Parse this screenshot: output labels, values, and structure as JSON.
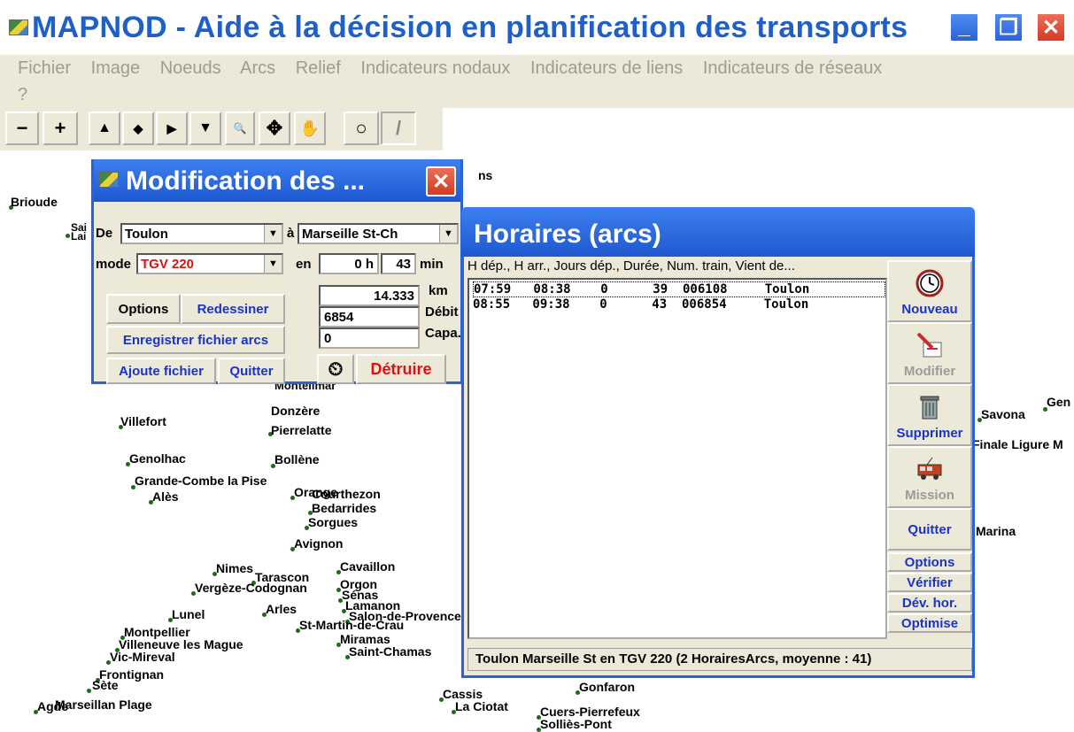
{
  "window": {
    "title": "MAPNOD - Aide à la décision en planification des transports"
  },
  "menu": {
    "items": [
      "Fichier",
      "Image",
      "Noeuds",
      "Arcs",
      "Relief",
      "Indicateurs nodaux",
      "Indicateurs de liens",
      "Indicateurs de réseaux"
    ],
    "help": "?"
  },
  "toolbar": {
    "buttons": [
      "−",
      "+",
      "▲",
      "◆",
      "▶",
      "▼",
      "🔍",
      "✥",
      "✋",
      "○",
      "/"
    ]
  },
  "map": {
    "cities": [
      "Brioude",
      "Sai",
      "Lai",
      "Villefort",
      "Donzère",
      "Pierrelatte",
      "Genolhac",
      "Bollène",
      "Grande-Combe la Pise",
      "Alès",
      "Orange",
      "Courthezon",
      "Bedarrides",
      "Sorgues",
      "Avignon",
      "Nimes",
      "Tarascon",
      "Cavaillon",
      "Vergèze-Codognan",
      "Orgon",
      "Sénas",
      "Lamanon",
      "Arles",
      "Lunel",
      "Salon-de-Provence",
      "St-Martin-de-Crau",
      "Montpellier",
      "Villeneuve les Mague",
      "Vic-Mireval",
      "Miramas",
      "Saint-Chamas",
      "Frontignan",
      "Sète",
      "Agde",
      "Marseillan Plage",
      "Cassis",
      "La Ciotat",
      "Gonfaron",
      "Cuers-Pierrefeux",
      "Solliès-Pont",
      "Savona",
      "Finale Ligure M",
      "Gen",
      "Marina",
      "Montelimar",
      "ns"
    ]
  },
  "modif": {
    "title": "Modification des ...",
    "de_label": "De",
    "de_value": "Toulon",
    "a_label": "à",
    "a_value": "Marseille St-Ch",
    "mode_label": "mode",
    "mode_value": "TGV 220",
    "en_label": "en",
    "hours": "0 h",
    "minutes": "43",
    "min_label": "min",
    "km_value": "14.333",
    "km_label": "km",
    "debit_value": "6854",
    "debit_label": "Débit",
    "capa_value": "0",
    "capa_label": "Capa.",
    "btn_options": "Options",
    "btn_redessiner": "Redessiner",
    "btn_enregistrer": "Enregistrer fichier arcs",
    "btn_ajoute": "Ajoute fichier",
    "btn_quitter": "Quitter",
    "btn_detruire": "Détruire"
  },
  "horaires": {
    "title": "Horaires (arcs)",
    "header": "H dép., H arr., Jours dép., Durée, Num. train, Vient de...",
    "rows": [
      "07:59   08:38    0      39  006108     Toulon",
      "08:55   09:38    0      43  006854     Toulon"
    ],
    "status": "Toulon         Marseille St en TGV 220  (2 HorairesArcs, moyenne : 41)",
    "btn_nouveau": "Nouveau",
    "btn_modifier": "Modifier",
    "btn_supprimer": "Supprimer",
    "btn_mission": "Mission",
    "btn_quitter": "Quitter",
    "btn_options": "Options",
    "btn_verifier": "Vérifier",
    "btn_dev": "Dév. hor.",
    "btn_optimise": "Optimise"
  }
}
